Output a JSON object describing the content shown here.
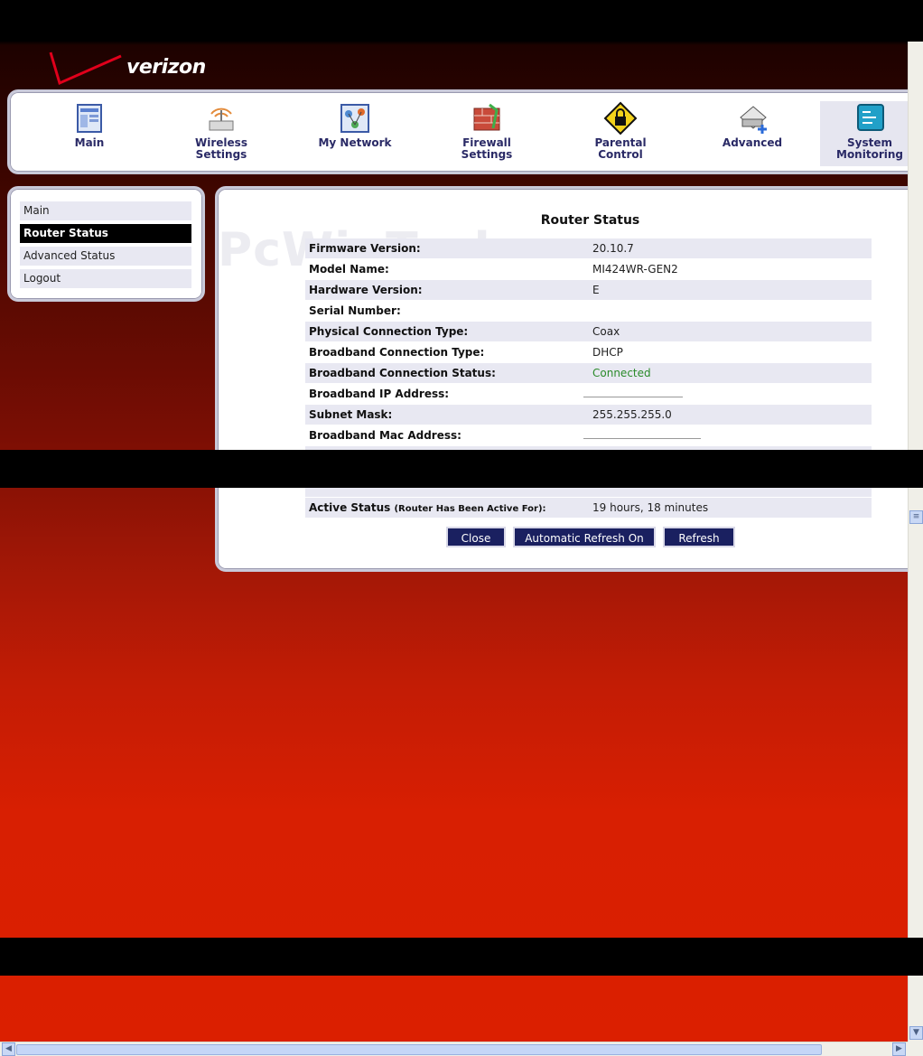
{
  "brand": {
    "name": "verizon"
  },
  "nav": [
    {
      "label": "Main",
      "icon": "main-icon"
    },
    {
      "label": "Wireless\nSettings",
      "icon": "wireless-icon"
    },
    {
      "label": "My Network",
      "icon": "network-icon"
    },
    {
      "label": "Firewall\nSettings",
      "icon": "firewall-icon"
    },
    {
      "label": "Parental\nControl",
      "icon": "lock-icon"
    },
    {
      "label": "Advanced",
      "icon": "advanced-icon"
    },
    {
      "label": "System\nMonitoring",
      "icon": "monitor-icon"
    }
  ],
  "sidebar": {
    "items": [
      {
        "label": "Main"
      },
      {
        "label": "Router Status"
      },
      {
        "label": "Advanced Status"
      },
      {
        "label": "Logout"
      }
    ],
    "active_index": 1
  },
  "watermark": "PcWinTech.com",
  "status": {
    "title": "Router Status",
    "rows": [
      {
        "label": "Firmware Version:",
        "value": "20.10.7"
      },
      {
        "label": "Model Name:",
        "value": "MI424WR-GEN2"
      },
      {
        "label": "Hardware Version:",
        "value": "E"
      },
      {
        "label": "Serial Number:",
        "value": ""
      },
      {
        "label": "Physical Connection Type:",
        "value": "Coax"
      },
      {
        "label": "Broadband Connection Type:",
        "value": "DHCP"
      },
      {
        "label": "Broadband Connection Status:",
        "value": "Connected"
      },
      {
        "label": "Broadband IP Address:",
        "value": ""
      },
      {
        "label": "Subnet Mask:",
        "value": "255.255.255.0"
      },
      {
        "label": "Broadband Mac Address:",
        "value": ""
      }
    ],
    "active_label": "Active Status",
    "active_sub": "(Router Has Been Active For):",
    "active_value": "19 hours, 18 minutes"
  },
  "buttons": {
    "close": "Close",
    "auto_refresh": "Automatic Refresh On",
    "refresh": "Refresh"
  },
  "colors": {
    "accent": "#1a2060",
    "connected": "#2a8a2a",
    "background_red": "#db1f00"
  }
}
